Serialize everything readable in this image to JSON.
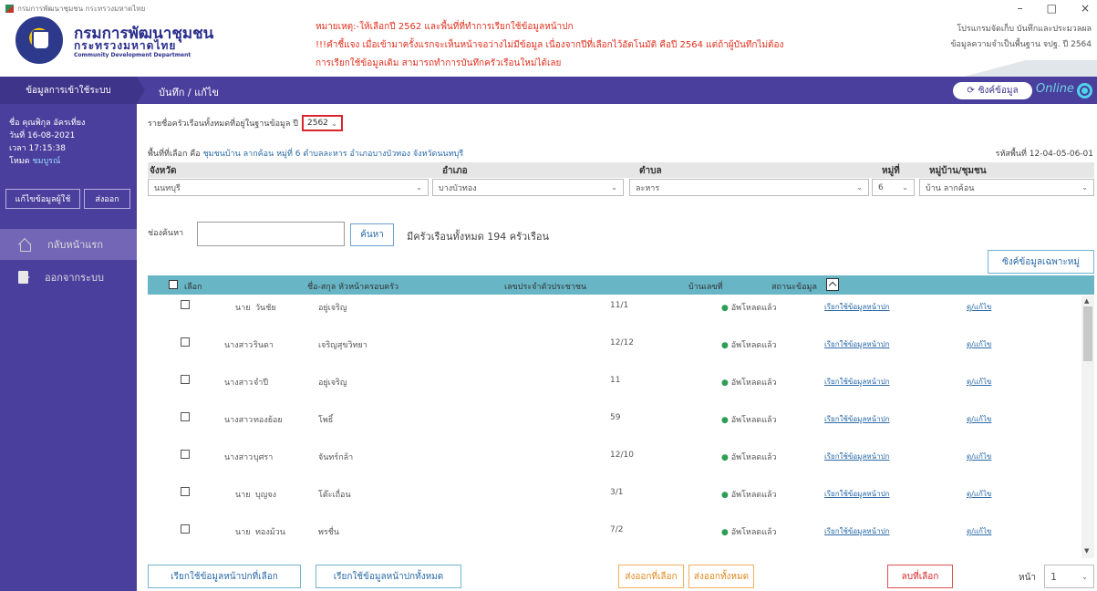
{
  "window": {
    "title": "กรมการพัฒนาชุมชน กระทรวงมหาดไทย",
    "minimize": "–",
    "maximize": "□",
    "close": "×"
  },
  "brand": {
    "name_th": "กรมการพัฒนาชุมชน",
    "ministry_th": "กระทรวงมหาดไทย",
    "name_en": "Community Development Department",
    "color": "#2a2f8c"
  },
  "notice": {
    "lines": [
      "หมายเหตุ:-ให้เลือกปี 2562 และพื้นที่ที่ทำการเรียกใช้ข้อมูลหน้าปก",
      "!!!คำชี้แจง เมื่อเข้ามาครั้งแรกจะเห็นหน้าจอว่างไม่มีข้อมูล เนื่องจากปีที่เลือกไว้อัตโนมัติ คือปี 2564 แต่ถ้าผู้บันทึกไม่ต้อง",
      "การเรียกใช้ข้อมูลเดิม สามารถทำการบันทึกครัวเรือนใหม่ได้เลย"
    ],
    "color": "#e0301e"
  },
  "program": {
    "line1": "โปรแกรมจัดเก็บ บันทึกและประมวลผล",
    "line2": "ข้อมูลความจำเป็นพื้นฐาน จปฐ. ปี 2564"
  },
  "nav": {
    "section": "ข้อมูลการเข้าใช้ระบบ",
    "breadcrumb": "บันทึก / แก้ไข",
    "sync_label": "ซิงค์ข้อมูล",
    "online_label": "Online",
    "bg_color": "#4a3f9c"
  },
  "user": {
    "name": "ชื่อ คุณพิกุล อัครเที่ยง",
    "date": "วันที่ 16-08-2021",
    "time": "เวลา 17:15:38",
    "mode_label": "โหมด",
    "mode_value": "ชมบูรณ์",
    "edit_user_btn": "แก้ไขข้อมูลผู้ใช้",
    "export_btn": "ส่งออก"
  },
  "menu": [
    {
      "label": "กลับหน้าแรก",
      "icon": "home-icon"
    },
    {
      "label": "ออกจากระบบ",
      "icon": "logout-icon"
    }
  ],
  "filters": {
    "year_prompt": "รายชื่อครัวเรือนทั้งหมดที่อยู่ในฐานข้อมูล ปี",
    "year": "2562",
    "area_prefix": "พื้นที่ที่เลือก คือ",
    "area_text": "ชุมชนบ้าน ลากค้อน หมู่ที่ 6 ตำบลละหาร อำเภอบางบัวทอง จังหวัดนนทบุรี",
    "area_code": "รหัสพื้นที่ 12-04-05-06-01",
    "headers": [
      "จังหวัด",
      "อำเภอ",
      "ตำบล",
      "หมู่ที่",
      "หมู่บ้าน/ชุมชน"
    ],
    "values": [
      "นนทบุรี",
      "บางบัวทอง",
      "ละหาร",
      "6",
      "บ้าน ลากค้อน"
    ]
  },
  "search": {
    "label": "ช่องค้นหา",
    "value": "",
    "button": "ค้นหา",
    "total": "มีครัวเรือนทั้งหมด 194 ครัวเรือน",
    "sync_area": "ซิงค์ข้อมูลเฉพาะหมู่"
  },
  "table": {
    "headers": {
      "select": "เลือก",
      "name": "ชื่อ-สกุล หัวหน้าครอบครัว",
      "id": "เลขประจำตัวประชาชน",
      "house": "บ้านเลขที่",
      "status": "สถานะข้อมูล"
    },
    "rows": [
      {
        "title": "นาย",
        "first": "วันชัย",
        "last": "อยู่เจริญ",
        "house": "11/1",
        "status": "อัพโหลดแล้ว",
        "fetch": "เรียกใช้ข้อมูลหน้าปก",
        "edit": "ดู/แก้ไข"
      },
      {
        "title": "นางสาว",
        "first": "รินดา",
        "last": "เจริญสุขวิทยา",
        "house": "12/12",
        "status": "อัพโหลดแล้ว",
        "fetch": "เรียกใช้ข้อมูลหน้าปก",
        "edit": "ดู/แก้ไข"
      },
      {
        "title": "นางสาว",
        "first": "จำปี",
        "last": "อยู่เจริญ",
        "house": "11",
        "status": "อัพโหลดแล้ว",
        "fetch": "เรียกใช้ข้อมูลหน้าปก",
        "edit": "ดู/แก้ไข"
      },
      {
        "title": "นางสาว",
        "first": "ทองย้อย",
        "last": "โพธิ์",
        "house": "59",
        "status": "อัพโหลดแล้ว",
        "fetch": "เรียกใช้ข้อมูลหน้าปก",
        "edit": "ดู/แก้ไข"
      },
      {
        "title": "นางสาว",
        "first": "บุศรา",
        "last": "จันทร์กล้า",
        "house": "12/10",
        "status": "อัพโหลดแล้ว",
        "fetch": "เรียกใช้ข้อมูลหน้าปก",
        "edit": "ดู/แก้ไข"
      },
      {
        "title": "นาย",
        "first": "บุญจง",
        "last": "โต๊ะเถื่อน",
        "house": "3/1",
        "status": "อัพโหลดแล้ว",
        "fetch": "เรียกใช้ข้อมูลหน้าปก",
        "edit": "ดู/แก้ไข"
      },
      {
        "title": "นาย",
        "first": "ทองม้วน",
        "last": "พรชื่น",
        "house": "7/2",
        "status": "อัพโหลดแล้ว",
        "fetch": "เรียกใช้ข้อมูลหน้าปก",
        "edit": "ดู/แก้ไข"
      }
    ]
  },
  "actions": {
    "fetch_selected": "เรียกใช้ข้อมูลหน้าปกที่เลือก",
    "fetch_all": "เรียกใช้ข้อมูลหน้าปกทั้งหมด",
    "export_selected": "ส่งออกที่เลือก",
    "export_all": "ส่งออกทั้งหมด",
    "delete_selected": "ลบที่เลือก",
    "page_label": "หน้า",
    "page_value": "1"
  }
}
